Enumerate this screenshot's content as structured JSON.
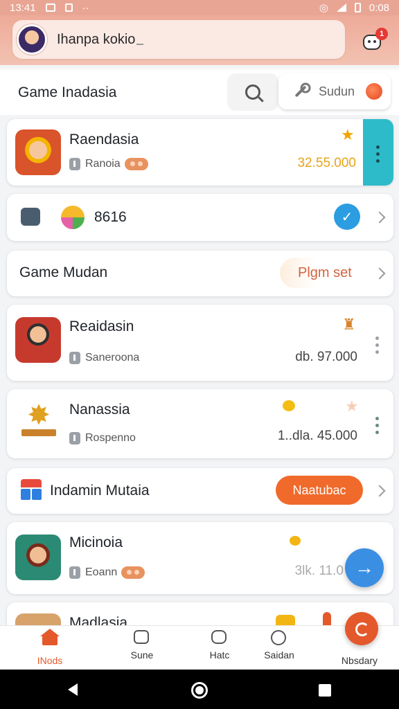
{
  "status_bar": {
    "time": "13:41",
    "right_time": "0:08"
  },
  "header": {
    "title": "Ihanpa kokio",
    "badge": "1"
  },
  "section": {
    "title": "Game Inadasia",
    "sudun_label": "Sudun"
  },
  "cards": {
    "c1": {
      "name": "Raendasia",
      "sub": "Ranoia",
      "price": "32.55.000"
    },
    "c2": {
      "value": "8616"
    },
    "c3": {
      "title": "Game Mudan",
      "action": "Plgm set"
    },
    "c4": {
      "name": "Reaidasin",
      "sub": "Saneroona",
      "price": "db. 97.000"
    },
    "c5": {
      "name": "Nanassia",
      "sub": "Rospenno",
      "price": "1..dla. 45.000"
    },
    "c6": {
      "title": "Indamin Mutaia",
      "action": "Naatubac"
    },
    "c7": {
      "name": "Micinoia",
      "sub": "Eoann",
      "price": "3lk. 11.0"
    },
    "c8": {
      "name": "Madlasia"
    }
  },
  "bottom_nav": [
    {
      "label": "INods"
    },
    {
      "label": "Sune"
    },
    {
      "label": "Hatc"
    },
    {
      "label": "Saidan"
    },
    {
      "label": "Nbsdary"
    }
  ],
  "colors": {
    "accent": "#e4592b",
    "header": "#eeaa98",
    "teal": "#2dbbc9",
    "blue": "#3b8fe3",
    "price_gold": "#e8a317"
  }
}
